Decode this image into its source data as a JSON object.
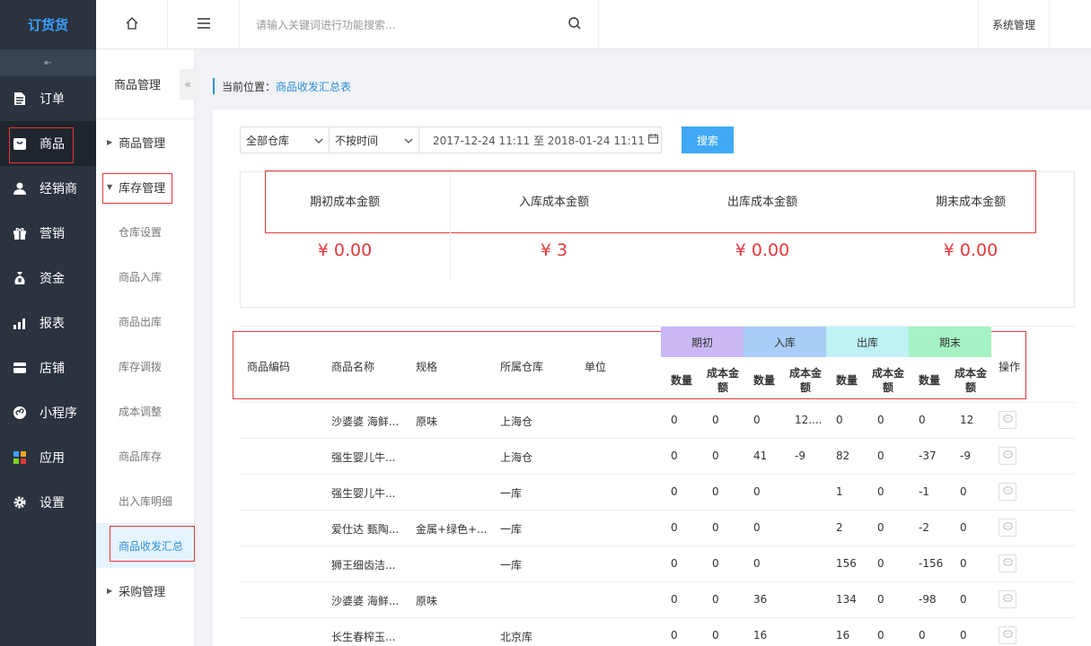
{
  "app": {
    "logo": "订货货"
  },
  "sidebar": {
    "items": [
      {
        "label": "订单",
        "icon": "document-icon"
      },
      {
        "label": "商品",
        "icon": "goods-icon"
      },
      {
        "label": "经销商",
        "icon": "user-icon"
      },
      {
        "label": "营销",
        "icon": "gift-icon"
      },
      {
        "label": "资金",
        "icon": "money-bag-icon"
      },
      {
        "label": "报表",
        "icon": "bar-chart-icon"
      },
      {
        "label": "店铺",
        "icon": "store-icon"
      },
      {
        "label": "小程序",
        "icon": "mini-program-icon"
      },
      {
        "label": "应用",
        "icon": "apps-icon"
      },
      {
        "label": "设置",
        "icon": "gear-icon"
      }
    ]
  },
  "subnav": {
    "title": "商品管理",
    "groups": [
      {
        "label": "商品管理"
      },
      {
        "label": "库存管理"
      },
      {
        "label": "采购管理"
      }
    ],
    "items": [
      "仓库设置",
      "商品入库",
      "商品出库",
      "库存调拨",
      "成本调整",
      "商品库存",
      "出入库明细",
      "商品收发汇总"
    ]
  },
  "topbar": {
    "search_placeholder": "请输入关键词进行功能搜索...",
    "system_label": "系统管理"
  },
  "breadcrumb": {
    "prefix": "当前位置：",
    "current": "商品收发汇总表"
  },
  "filters": {
    "warehouse": "全部仓库",
    "time_mode": "不按时间",
    "date_range": "2017-12-24 11:11 至 2018-01-24 11:11",
    "search_label": "搜索"
  },
  "summary": [
    {
      "label": "期初成本金额",
      "value": "¥ 0.00"
    },
    {
      "label": "入库成本金额",
      "value": "¥ 3"
    },
    {
      "label": "出库成本金额",
      "value": "¥ 0.00"
    },
    {
      "label": "期末成本金额",
      "value": "¥ 0.00"
    }
  ],
  "table": {
    "headers": {
      "code": "商品编码",
      "name": "商品名称",
      "spec": "规格",
      "warehouse": "所属仓库",
      "unit": "单位",
      "action": "操作"
    },
    "groups": [
      {
        "label": "期初",
        "color": "#c9b8f5"
      },
      {
        "label": "入库",
        "color": "#a8cdf7"
      },
      {
        "label": "出库",
        "color": "#bff2f5"
      },
      {
        "label": "期末",
        "color": "#a6f2c4"
      }
    ],
    "sub_headers": {
      "qty": "数量",
      "cost": "成本金额"
    },
    "rows": [
      {
        "name": "沙婆婆 海鲜...",
        "spec": "原味",
        "warehouse": "上海仓",
        "v": [
          "0",
          "0",
          "0",
          "12....",
          "0",
          "0",
          "0",
          "12"
        ]
      },
      {
        "name": "强生婴儿牛...",
        "spec": "",
        "warehouse": "上海仓",
        "v": [
          "0",
          "0",
          "41",
          "-9",
          "82",
          "0",
          "-37",
          "-9"
        ]
      },
      {
        "name": "强生婴儿牛...",
        "spec": "",
        "warehouse": "一库",
        "v": [
          "0",
          "0",
          "0",
          "",
          "1",
          "0",
          "-1",
          "0"
        ]
      },
      {
        "name": "爱仕达 甄陶...",
        "spec": "金属+绿色+...",
        "warehouse": "一库",
        "v": [
          "0",
          "0",
          "0",
          "",
          "2",
          "0",
          "-2",
          "0"
        ]
      },
      {
        "name": "狮王细齿洁...",
        "spec": "",
        "warehouse": "一库",
        "v": [
          "0",
          "0",
          "0",
          "",
          "156",
          "0",
          "-156",
          "0"
        ]
      },
      {
        "name": "沙婆婆 海鲜...",
        "spec": "原味",
        "warehouse": "",
        "v": [
          "0",
          "0",
          "36",
          "",
          "134",
          "0",
          "-98",
          "0"
        ]
      },
      {
        "name": "长生春榨玉...",
        "spec": "",
        "warehouse": "北京库",
        "v": [
          "0",
          "0",
          "16",
          "",
          "16",
          "0",
          "0",
          "0"
        ]
      }
    ]
  }
}
